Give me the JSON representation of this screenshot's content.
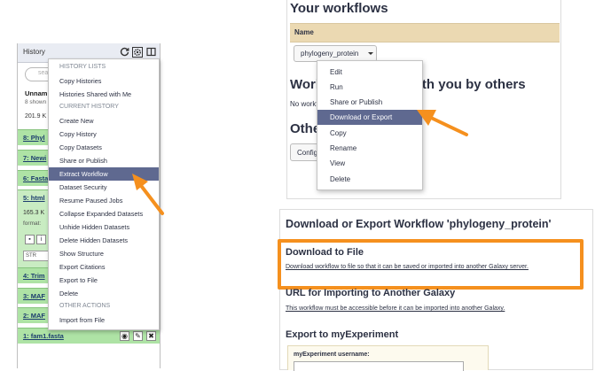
{
  "history": {
    "title": "History",
    "search_placeholder": "sear",
    "name_partial": "Unnam",
    "shown_partial": "8 shown",
    "size_partial": "201.9 K",
    "datasets": [
      {
        "label": "8: Phyl"
      },
      {
        "label": "7: Newi"
      },
      {
        "label": "6: Fasta"
      },
      {
        "label": "5: html"
      },
      {
        "label": "4: Trim"
      },
      {
        "label": "3: MAF"
      },
      {
        "label": "2: MAF"
      },
      {
        "label": "1: fam1.fasta"
      }
    ],
    "expanded_size": "165.3 K",
    "expanded_format": "format:",
    "expanded_preview": "STR"
  },
  "history_menu": {
    "sections": [
      {
        "header": "History Lists",
        "items": [
          "Copy Histories",
          "Histories Shared with Me"
        ]
      },
      {
        "header": "Current History",
        "items": [
          "Create New",
          "Copy History",
          "Copy Datasets",
          "Share or Publish",
          "Extract Workflow",
          "Dataset Security",
          "Resume Paused Jobs",
          "Collapse Expanded Datasets",
          "Unhide Hidden Datasets",
          "Delete Hidden Datasets",
          "Show Structure",
          "Export Citations",
          "Export to File",
          "Delete"
        ]
      },
      {
        "header": "Other Actions",
        "items": [
          "Import from File"
        ]
      }
    ],
    "selected": "Extract Workflow"
  },
  "workflows": {
    "title": "Your workflows",
    "col_name": "Name",
    "row_button": "phylogeny_protein",
    "shared_title": "Workflows shared with you by others",
    "shared_empty": "No workflows have been shared with you.",
    "other_title": "Other",
    "other_button": "Configure",
    "menu": [
      "Edit",
      "Run",
      "Share or Publish",
      "Download or Export",
      "Copy",
      "Rename",
      "View",
      "Delete"
    ],
    "menu_selected": "Download or Export"
  },
  "download": {
    "title": "Download or Export Workflow 'phylogeny_protein'",
    "file_title": "Download to File",
    "file_link": "Download workflow to file so that it can be saved or imported into another Galaxy server.",
    "url_title": "URL for Importing to Another Galaxy",
    "url_text": "This workflow must be accessible before it can be imported into another Galaxy.",
    "myexp_title": "Export to myExperiment",
    "myexp_label": "myExperiment username:"
  },
  "colors": {
    "accent_orange": "#f5901e",
    "menu_selected_bg": "#5f6990",
    "dataset_ok": "#aee3a5",
    "table_header": "#ebd9b2"
  }
}
